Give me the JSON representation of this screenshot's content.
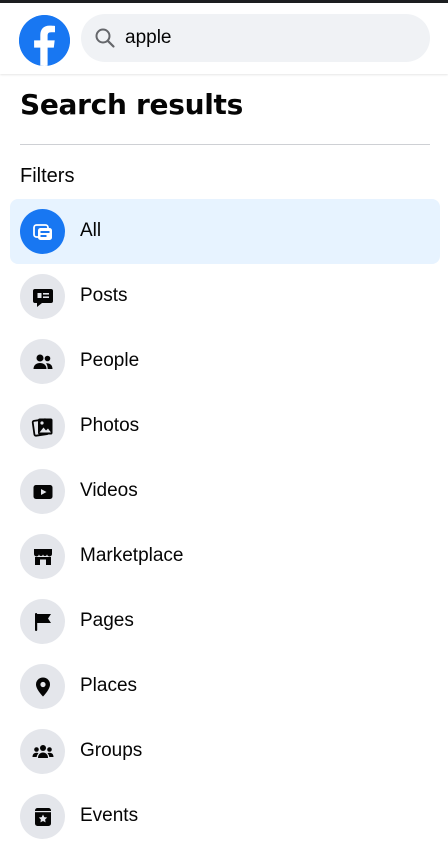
{
  "header": {
    "logo_icon": "facebook-logo",
    "search": {
      "icon": "search-icon",
      "value": "apple"
    }
  },
  "page": {
    "title": "Search results",
    "filters_heading": "Filters"
  },
  "filters": [
    {
      "label": "All",
      "icon": "all-results-icon",
      "selected": true
    },
    {
      "label": "Posts",
      "icon": "posts-icon",
      "selected": false
    },
    {
      "label": "People",
      "icon": "people-icon",
      "selected": false
    },
    {
      "label": "Photos",
      "icon": "photos-icon",
      "selected": false
    },
    {
      "label": "Videos",
      "icon": "videos-icon",
      "selected": false
    },
    {
      "label": "Marketplace",
      "icon": "marketplace-icon",
      "selected": false
    },
    {
      "label": "Pages",
      "icon": "pages-flag-icon",
      "selected": false
    },
    {
      "label": "Places",
      "icon": "places-pin-icon",
      "selected": false
    },
    {
      "label": "Groups",
      "icon": "groups-icon",
      "selected": false
    },
    {
      "label": "Events",
      "icon": "events-icon",
      "selected": false
    }
  ],
  "colors": {
    "brand": "#1877f2",
    "selected_bg": "#e7f3ff",
    "icon_bg": "#e4e6eb",
    "search_bg": "#f0f2f5"
  }
}
